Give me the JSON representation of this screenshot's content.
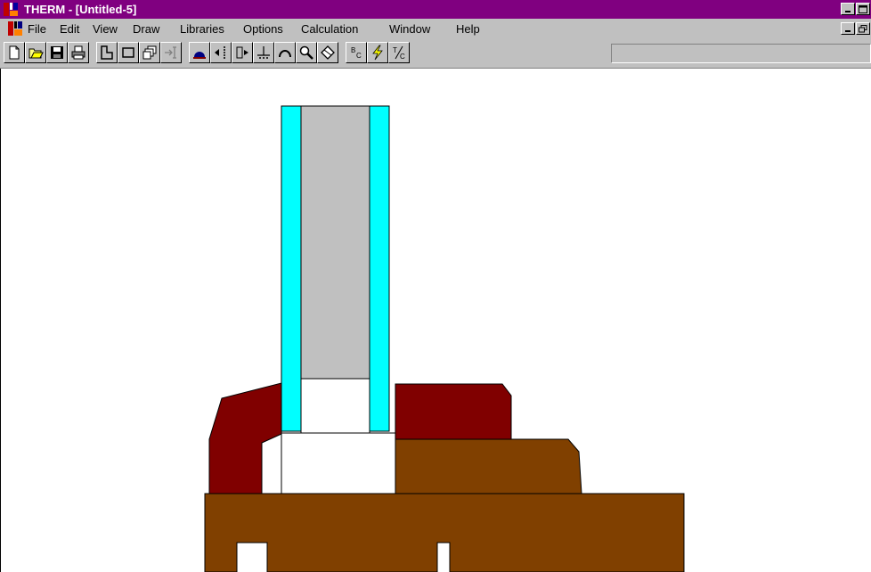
{
  "window": {
    "title": "THERM - [Untitled-5]"
  },
  "menu": {
    "items": [
      {
        "label": "File"
      },
      {
        "label": "Edit"
      },
      {
        "label": "View"
      },
      {
        "label": "Draw"
      },
      {
        "label": "Libraries"
      },
      {
        "label": "Options"
      },
      {
        "label": "Calculation"
      },
      {
        "label": "Window"
      },
      {
        "label": "Help"
      }
    ]
  },
  "toolbar": {
    "buttons": [
      {
        "icon": "new-file-icon"
      },
      {
        "icon": "open-folder-icon"
      },
      {
        "icon": "save-disk-icon"
      },
      {
        "icon": "print-icon"
      },
      {
        "icon": "polygon-draw-icon"
      },
      {
        "icon": "rectangle-draw-icon"
      },
      {
        "icon": "fill-void-icon"
      },
      {
        "icon": "insert-point-icon"
      },
      {
        "icon": "locator-icon"
      },
      {
        "icon": "move-point-left-icon"
      },
      {
        "icon": "move-point-right-icon"
      },
      {
        "icon": "align-point-icon"
      },
      {
        "icon": "arc-icon"
      },
      {
        "icon": "zoom-icon"
      },
      {
        "icon": "rotate-icon"
      },
      {
        "icon": "boundary-conditions-icon"
      },
      {
        "icon": "calculate-lightning-icon"
      },
      {
        "icon": "temperature-celsius-icon"
      }
    ],
    "status_value": ""
  },
  "drawing": {
    "colors": {
      "glass": "#00ffff",
      "gas_fill": "#c0c0c0",
      "dark_frame": "#800000",
      "wood_frame": "#804000",
      "void": "#ffffff",
      "outline": "#000000"
    }
  },
  "colors": {
    "title_bar": "#800080",
    "chrome": "#c0c0c0"
  }
}
